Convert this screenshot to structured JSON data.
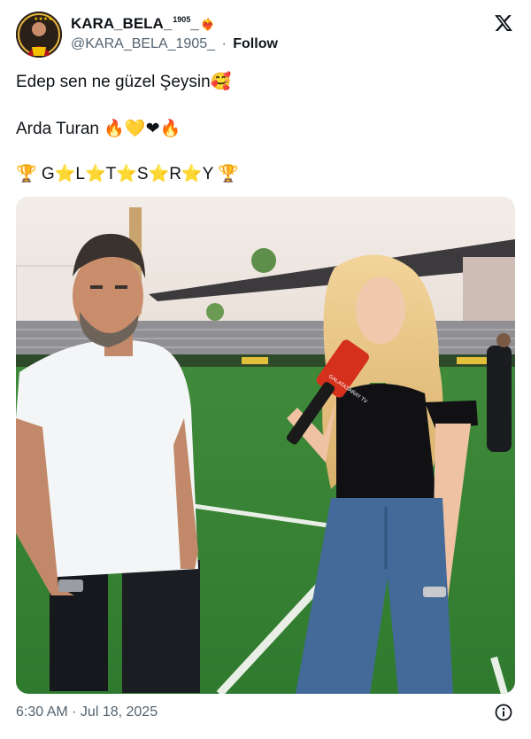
{
  "user": {
    "display_name": "KARA_BELA_",
    "display_name_sup": "1905",
    "display_name_suffix": "_",
    "display_name_emoji": "❤️‍🔥",
    "handle": "@KARA_BELA_1905_",
    "separator": "·",
    "follow_label": "Follow",
    "avatar_icon": "team-badge-avatar"
  },
  "tweet": {
    "line1": "Edep sen ne güzel Şeysin🥰",
    "line2": "Arda Turan 🔥💛❤🔥",
    "line3": "🏆 G⭐L⭐T⭐S⭐R⭐Y 🏆"
  },
  "media": {
    "microphone_text": "GALATASARAY TV"
  },
  "footer": {
    "timestamp": "6:30 AM · Jul 18, 2025",
    "info_icon": "info-icon"
  },
  "brand": {
    "logo": "x-logo",
    "text_color": "#0f1419",
    "secondary_color": "#536471"
  }
}
